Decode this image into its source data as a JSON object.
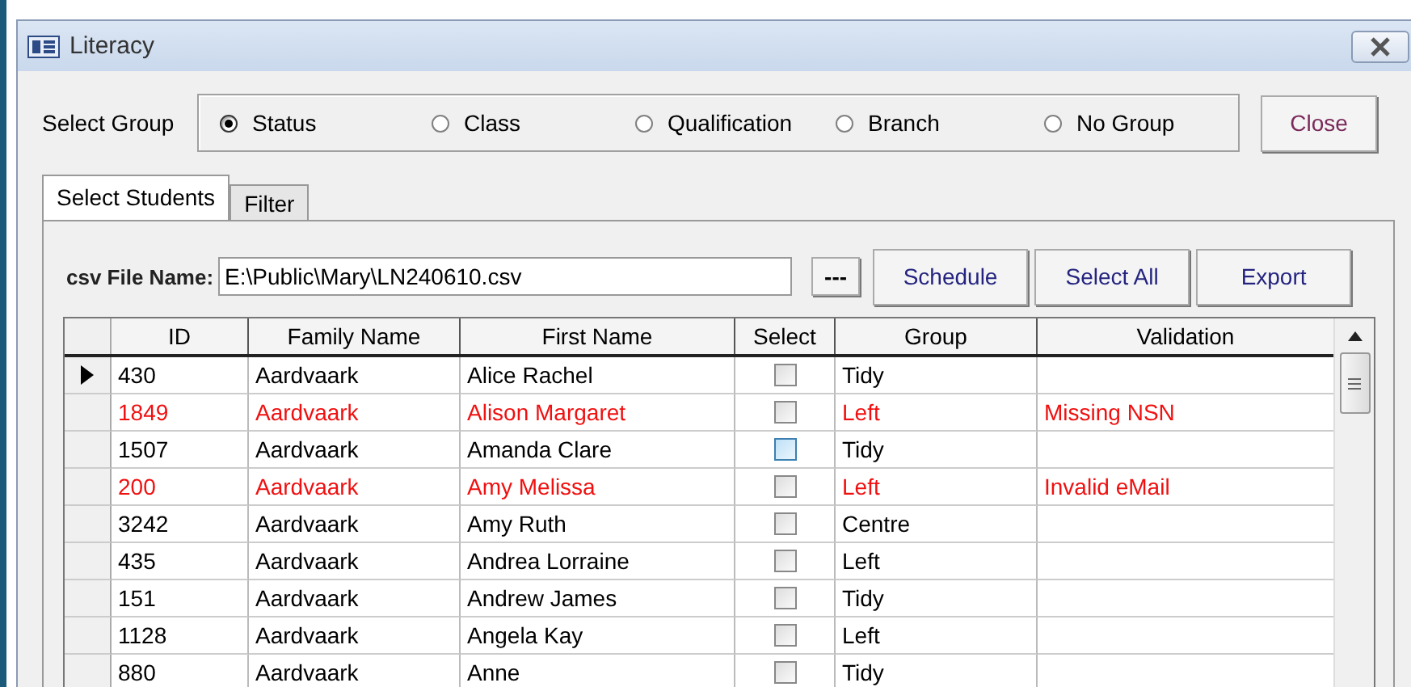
{
  "window": {
    "title": "Literacy"
  },
  "select_group": {
    "label": "Select Group",
    "options": [
      {
        "label": "Status",
        "selected": true
      },
      {
        "label": "Class",
        "selected": false
      },
      {
        "label": "Qualification",
        "selected": false
      },
      {
        "label": "Branch",
        "selected": false
      },
      {
        "label": "No Group",
        "selected": false
      }
    ]
  },
  "close_button": "Close",
  "tabs": [
    {
      "label": "Select Students",
      "selected": true
    },
    {
      "label": "Filter",
      "selected": false
    }
  ],
  "csv_file": {
    "label": "csv File Name:",
    "value": "E:\\Public\\Mary\\LN240610.csv"
  },
  "buttons": [
    {
      "label": "---",
      "kind": "browse"
    },
    {
      "label": "Schedule",
      "kind": "action"
    },
    {
      "label": "Select All",
      "kind": "action"
    },
    {
      "label": "Export",
      "kind": "action"
    }
  ],
  "table": {
    "columns": [
      "ID",
      "Family Name",
      "First Name",
      "Select",
      "Group",
      "Validation"
    ],
    "rows": [
      {
        "id": "430",
        "family_name": "Aardvaark",
        "first_name": "Alice Rachel",
        "checked": false,
        "hovered": false,
        "group": "Tidy",
        "current": true,
        "invalid": false
      },
      {
        "id": "1849",
        "family_name": "Aardvaark",
        "first_name": "Alison Margaret",
        "checked": false,
        "hovered": false,
        "group": "Left",
        "validation": "Missing NSN",
        "current": false,
        "invalid": true
      },
      {
        "id": "1507",
        "family_name": "Aardvaark",
        "first_name": "Amanda Clare",
        "checked": false,
        "hovered": true,
        "group": "Tidy",
        "current": false,
        "invalid": false
      },
      {
        "id": "200",
        "family_name": "Aardvaark",
        "first_name": "Amy Melissa",
        "checked": false,
        "hovered": false,
        "group": "Left",
        "validation": "Invalid eMail",
        "current": false,
        "invalid": true
      },
      {
        "id": "3242",
        "family_name": "Aardvaark",
        "first_name": "Amy Ruth",
        "checked": false,
        "hovered": false,
        "group": "Centre",
        "current": false,
        "invalid": false
      },
      {
        "id": "435",
        "family_name": "Aardvaark",
        "first_name": "Andrea Lorraine",
        "checked": false,
        "hovered": false,
        "group": "Left",
        "current": false,
        "invalid": false
      },
      {
        "id": "151",
        "family_name": "Aardvaark",
        "first_name": "Andrew James",
        "checked": false,
        "hovered": false,
        "group": "Tidy",
        "current": false,
        "invalid": false
      },
      {
        "id": "1128",
        "family_name": "Aardvaark",
        "first_name": "Angela Kay",
        "checked": false,
        "hovered": false,
        "group": "Left",
        "current": false,
        "invalid": false
      },
      {
        "id": "880",
        "family_name": "Aardvaark",
        "first_name": "Anne",
        "checked": false,
        "hovered": false,
        "group": "Tidy",
        "current": false,
        "invalid": false
      }
    ]
  }
}
